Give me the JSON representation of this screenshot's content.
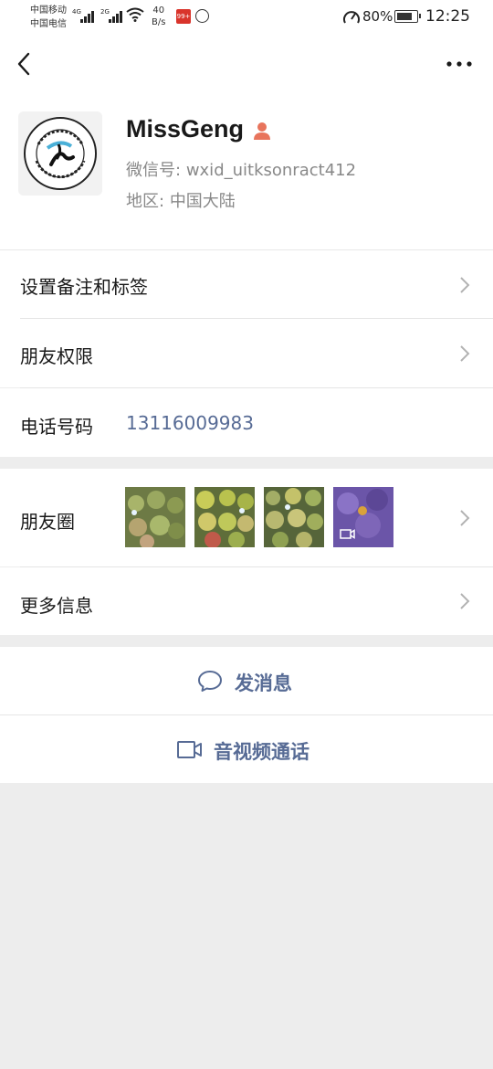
{
  "status_bar": {
    "carrier_1": "中国移动",
    "carrier_2": "中国电信",
    "net_1": "4G",
    "net_2": "2G",
    "speed_value": "40",
    "speed_unit": "B/s",
    "app_badge": "99+",
    "battery": "80%",
    "battery_level": 0.8,
    "time": "12:25"
  },
  "nav": {
    "back_icon": "back-chevron-icon",
    "more_icon": "more-dots-icon"
  },
  "profile": {
    "nickname": "MissGeng",
    "avatar_text": "WARU Ci&MissGeng8DE",
    "wxid_label": "微信号:",
    "wxid_value": "wxid_uitksonract412",
    "region_label": "地区:",
    "region_value": "中国大陆"
  },
  "rows": {
    "remark": {
      "label": "设置备注和标签"
    },
    "permission": {
      "label": "朋友权限"
    },
    "phone": {
      "label": "电话号码",
      "value": "13116009983"
    },
    "moments": {
      "label": "朋友圈"
    },
    "more_info": {
      "label": "更多信息"
    }
  },
  "actions": {
    "message": "发消息",
    "call": "音视频通话"
  },
  "colors": {
    "link": "#576b95",
    "background": "#ededed",
    "badge": "#e8745c"
  }
}
